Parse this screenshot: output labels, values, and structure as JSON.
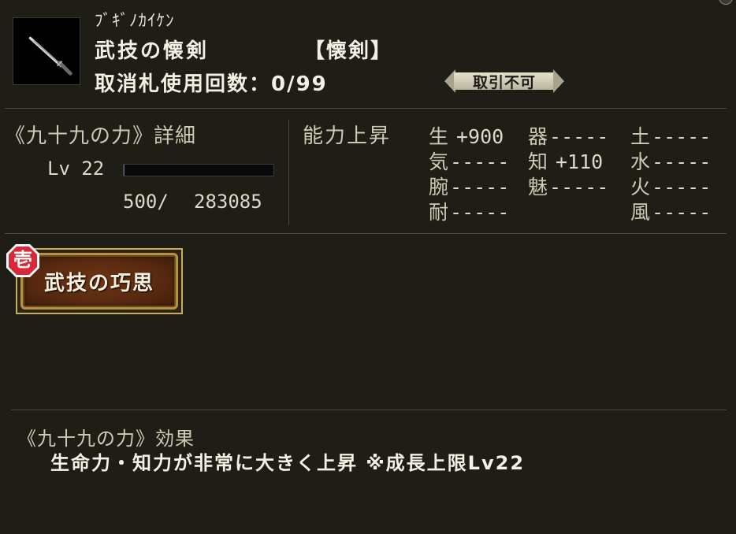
{
  "item": {
    "reading": "ﾌﾞｷﾞﾉｶｲｹﾝ",
    "name": "武技の懐剣",
    "type": "【懐剣】",
    "cancel_count": "取消札使用回数：0/99",
    "trade_status": "取引不可",
    "icon": "dagger-icon"
  },
  "detail": {
    "title": "《九十九の力》詳細",
    "level": "Lv 22",
    "exp_current": "500/",
    "exp_max": "283085",
    "exp_fraction": 0.0018
  },
  "stats": {
    "title": "能力上昇",
    "items": [
      {
        "k": "生",
        "v": "+900"
      },
      {
        "k": "器",
        "v": "-----"
      },
      {
        "k": "土",
        "v": "-----"
      },
      {
        "k": "気",
        "v": "-----"
      },
      {
        "k": "知",
        "v": "+110"
      },
      {
        "k": "水",
        "v": "-----"
      },
      {
        "k": "腕",
        "v": "-----"
      },
      {
        "k": "魅",
        "v": "-----"
      },
      {
        "k": "火",
        "v": "-----"
      },
      {
        "k": "耐",
        "v": "-----"
      },
      {
        "k": "風",
        "v": "-----"
      }
    ]
  },
  "skill": {
    "rank": "壱",
    "label": "武技の巧思"
  },
  "effect": {
    "title": "《九十九の力》効果",
    "text": "生命力・知力が非常に大きく上昇 ※成長上限Lv22"
  },
  "colors": {
    "background": "#1e1d16",
    "label": "#cfcab4",
    "text": "#f2efe4",
    "button_gold": "#c9ad5a",
    "button_brown": "#5a2a10",
    "badge_red": "#d8283a"
  }
}
